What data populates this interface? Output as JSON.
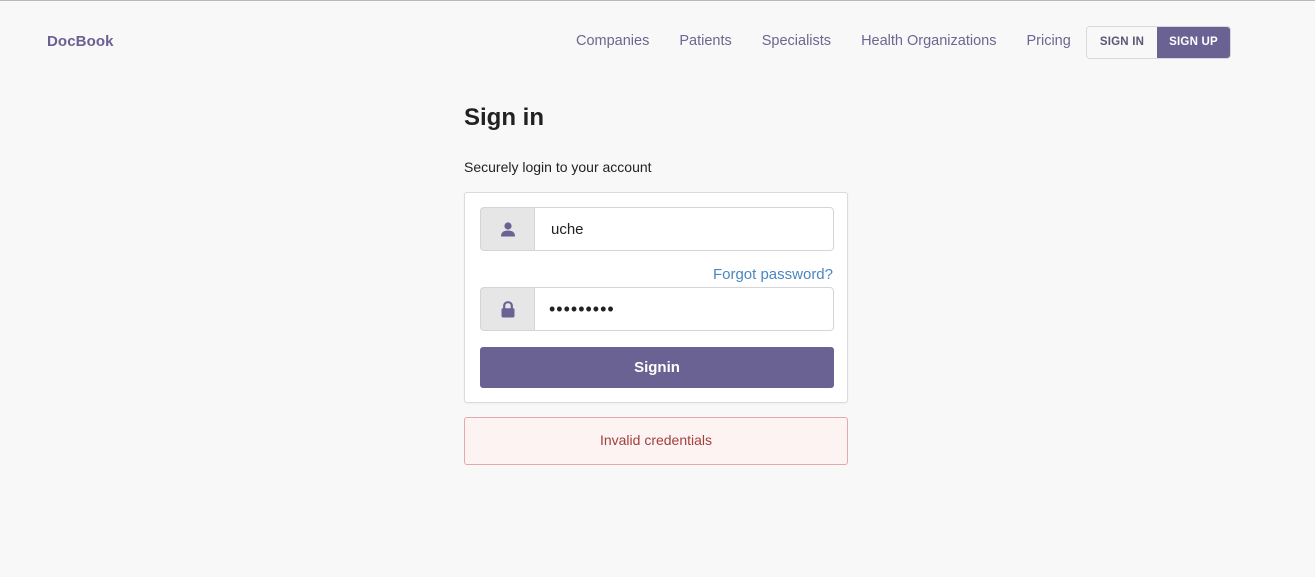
{
  "brand": {
    "name": "DocBook"
  },
  "nav": {
    "links": [
      {
        "label": "Companies"
      },
      {
        "label": "Patients"
      },
      {
        "label": "Specialists"
      },
      {
        "label": "Health Organizations"
      },
      {
        "label": "Pricing"
      }
    ],
    "signin_label": "SIGN IN",
    "signup_label": "SIGN UP"
  },
  "signin": {
    "title": "Sign in",
    "subtitle": "Securely login to your account",
    "username": {
      "value": "uche",
      "icon": "user-icon"
    },
    "forgot_label": "Forgot password?",
    "password": {
      "value": "•••••••••",
      "icon": "lock-icon"
    },
    "submit_label": "Signin",
    "error": "Invalid credentials"
  },
  "colors": {
    "accent": "#6b6294",
    "link": "#4a87c0",
    "error_text": "#a2403d",
    "error_bg": "#fdf3f3",
    "page_bg": "#f8f8f8"
  }
}
